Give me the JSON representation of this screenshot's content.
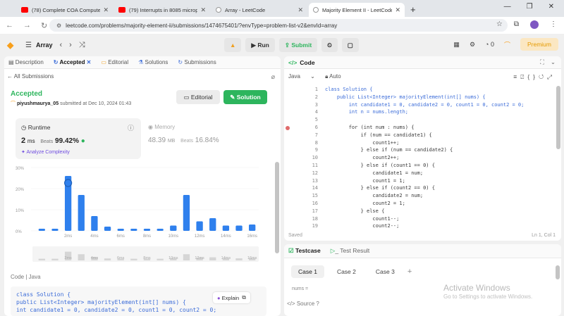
{
  "browser": {
    "tabs": [
      {
        "title": "(78) Complete COA Computer O",
        "icon": "youtube-icon",
        "active": false
      },
      {
        "title": "(79) Interrupts in 8085 micropro",
        "icon": "youtube-icon",
        "active": false
      },
      {
        "title": "Array - LeetCode",
        "icon": "leetcode-icon",
        "active": false
      },
      {
        "title": "Majority Element II - LeetCode",
        "icon": "leetcode-icon",
        "active": true
      }
    ],
    "url": "leetcode.com/problems/majority-element-ii/submissions/1474675401/?envType=problem-list-v2&envId=array"
  },
  "header": {
    "problem_list": "Array",
    "run_label": "Run",
    "submit_label": "Submit",
    "coins": "0",
    "premium_label": "Premium"
  },
  "left": {
    "tabs": [
      "Description",
      "Accepted",
      "Editorial",
      "Solutions",
      "Submissions"
    ],
    "all_submissions": "All Submissions",
    "status": "Accepted",
    "username": "piyushmaurya_05",
    "submitted_at": "submitted at Dec 10, 2024 01:43",
    "editorial_btn": "Editorial",
    "solution_btn": "Solution",
    "runtime": {
      "label": "Runtime",
      "value": "2",
      "unit": "ms",
      "beats_label": "Beats",
      "beats": "99.42%",
      "analyze": "Analyze Complexity"
    },
    "memory": {
      "label": "Memory",
      "value": "48.39",
      "unit": "MB",
      "beats_label": "Beats",
      "beats": "16.84%"
    },
    "code_header": "Code  |  Java",
    "code_lines": [
      "class Solution {",
      "    public List<Integer> majorityElement(int[] nums) {",
      "        int candidate1 = 0, candidate2 = 0, count1 = 0, count2 = 0;"
    ],
    "explain_label": "Explain"
  },
  "chart_data": {
    "type": "bar",
    "ylabels": [
      "30%",
      "20%",
      "10%",
      "0%"
    ],
    "ylim": [
      0,
      30
    ],
    "xticks": [
      "2ms",
      "4ms",
      "6ms",
      "8ms",
      "10ms",
      "12ms",
      "14ms",
      "16ms"
    ],
    "values": [
      1,
      1,
      26,
      17,
      7,
      2,
      1,
      1,
      1,
      1,
      2.5,
      17,
      4.5,
      6,
      2.5,
      2.5,
      3
    ],
    "highlight_index": 2,
    "accent": "#2f80ed"
  },
  "editor": {
    "title": "Code",
    "language": "Java",
    "auto_label": "Auto",
    "lines": [
      "class Solution {",
      "    public List<Integer> majorityElement(int[] nums) {",
      "        int candidate1 = 0, candidate2 = 0, count1 = 0, count2 = 0;",
      "        int n = nums.length;",
      "",
      "        for (int num : nums) {",
      "            if (num == candidate1) {",
      "                count1++;",
      "            } else if (num == candidate2) {",
      "                count2++;",
      "            } else if (count1 == 0) {",
      "                candidate1 = num;",
      "                count1 = 1;",
      "            } else if (count2 == 0) {",
      "                candidate2 = num;",
      "                count2 = 1;",
      "            } else {",
      "                count1--;",
      "                count2--;"
    ],
    "saved": "Saved",
    "position": "Ln 1, Col 1"
  },
  "testcase": {
    "tab_testcase": "Testcase",
    "tab_result": "Test Result",
    "cases": [
      "Case 1",
      "Case 2",
      "Case 3"
    ],
    "nums_label": "nums =",
    "source_label": "Source"
  },
  "watermark": {
    "line1": "Activate Windows",
    "line2": "Go to Settings to activate Windows."
  }
}
